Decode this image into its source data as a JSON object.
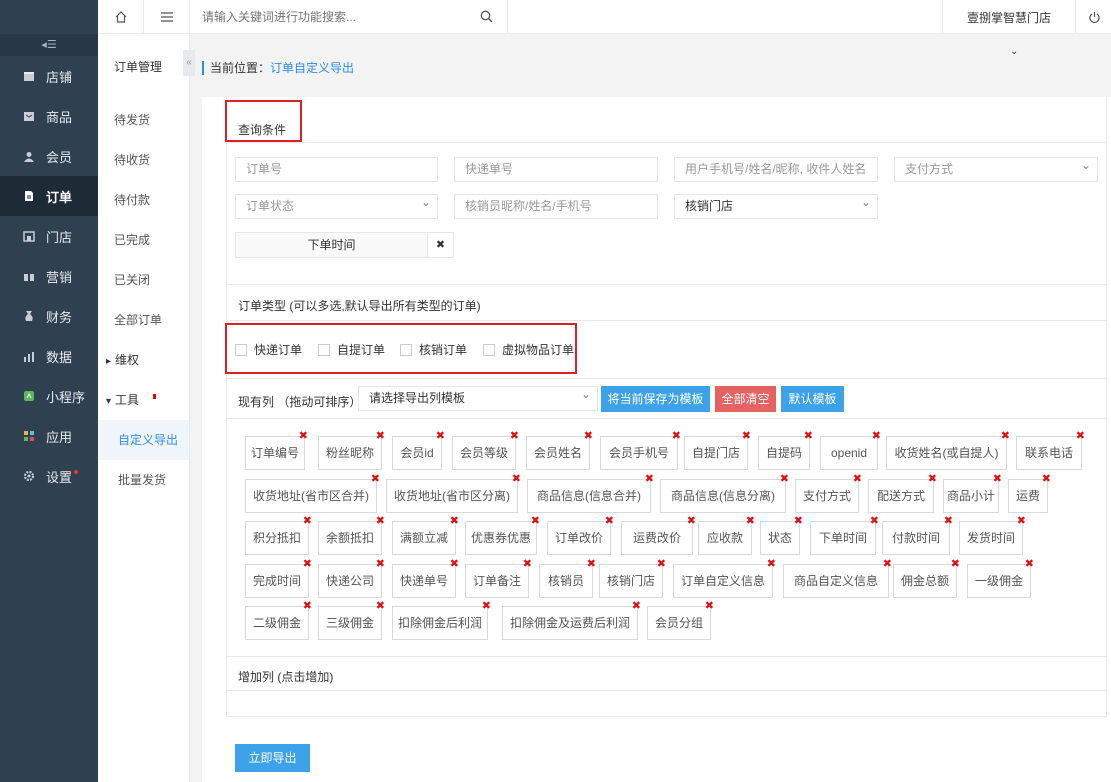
{
  "sidebar": {
    "collapse_icon": "menu-collapse-icon",
    "items": [
      {
        "label": "店铺",
        "icon": "store-icon"
      },
      {
        "label": "商品",
        "icon": "goods-icon"
      },
      {
        "label": "会员",
        "icon": "user-icon"
      },
      {
        "label": "订单",
        "icon": "order-icon",
        "active": true
      },
      {
        "label": "门店",
        "icon": "shop-icon"
      },
      {
        "label": "营销",
        "icon": "gift-icon"
      },
      {
        "label": "财务",
        "icon": "money-icon"
      },
      {
        "label": "数据",
        "icon": "chart-icon"
      },
      {
        "label": "小程序",
        "icon": "miniapp-icon"
      },
      {
        "label": "应用",
        "icon": "apps-icon"
      },
      {
        "label": "设置",
        "icon": "gear-icon"
      }
    ]
  },
  "topbar": {
    "search_placeholder": "请输入关键词进行功能搜索...",
    "store_name": "壹捌掌智慧门店"
  },
  "submenu": {
    "title": "订单管理",
    "toggle": "«",
    "items": [
      {
        "label": "待发货"
      },
      {
        "label": "待收货"
      },
      {
        "label": "待付款"
      },
      {
        "label": "已完成"
      },
      {
        "label": "已关闭"
      },
      {
        "label": "全部订单"
      },
      {
        "label": "维权",
        "prefix": "▸"
      },
      {
        "label": "工具",
        "prefix": "▾"
      },
      {
        "label": "自定义导出"
      },
      {
        "label": "批量发货"
      }
    ]
  },
  "breadcrumb": {
    "prefix": "当前位置：",
    "current": "订单自定义导出"
  },
  "query": {
    "title": "查询条件",
    "order_no": "订单号",
    "express_no": "快递单号",
    "user_search": "用户手机号/姓名/昵称, 收件人姓名",
    "pay_method": "支付方式",
    "order_status": "订单状态",
    "verifier": "核销员昵称/姓名/手机号",
    "verify_store": "核销门店",
    "order_time": "下单时间",
    "clear": "✖"
  },
  "order_type": {
    "title": "订单类型 (可以多选,默认导出所有类型的订单)",
    "options": [
      "快递订单",
      "自提订单",
      "核销订单",
      "虚拟物品订单"
    ]
  },
  "columns": {
    "label": "现有列 （拖动可排序）",
    "template_placeholder": "请选择导出列模板",
    "save_template": "将当前保存为模板",
    "clear_all": "全部清空",
    "default_template": "默认模板",
    "tags": [
      "订单编号",
      "粉丝昵称",
      "会员id",
      "会员等级",
      "会员姓名",
      "会员手机号",
      "自提门店",
      "自提码",
      "openid",
      "收货姓名(或自提人)",
      "联系电话",
      "收货地址(省市区合并)",
      "收货地址(省市区分离)",
      "商品信息(信息合并)",
      "商品信息(信息分离)",
      "支付方式",
      "配送方式",
      "商品小计",
      "运费",
      "积分抵扣",
      "余额抵扣",
      "满额立减",
      "优惠券优惠",
      "订单改价",
      "运费改价",
      "应收款",
      "状态",
      "下单时间",
      "付款时间",
      "发货时间",
      "完成时间",
      "快递公司",
      "快递单号",
      "订单备注",
      "核销员",
      "核销门店",
      "订单自定义信息",
      "商品自定义信息",
      "佣金总额",
      "一级佣金",
      "二级佣金",
      "三级佣金",
      "扣除佣金后利润",
      "扣除佣金及运费后利润",
      "会员分组"
    ]
  },
  "add_columns": {
    "title": "增加列 (点击增加)"
  },
  "export": {
    "label": "立即导出"
  }
}
